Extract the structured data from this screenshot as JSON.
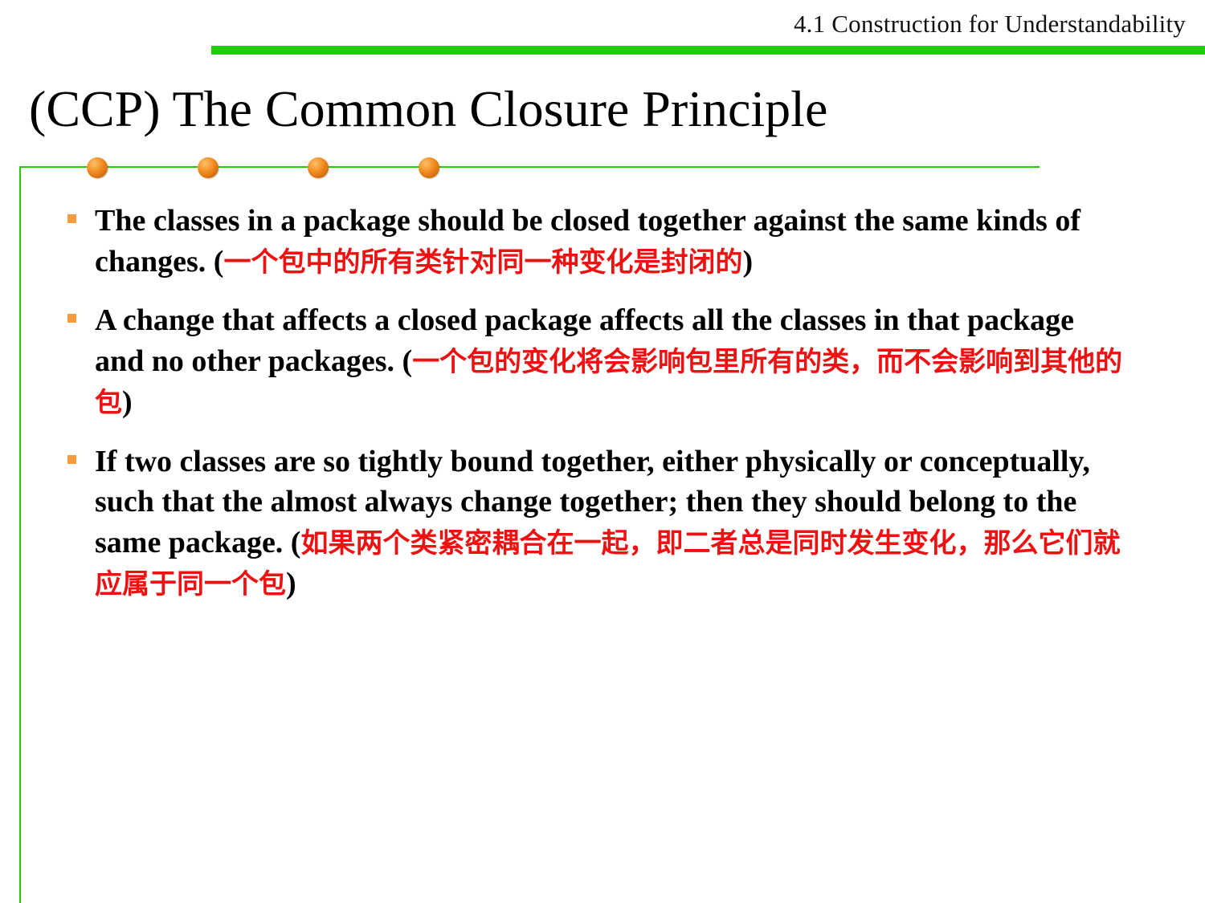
{
  "header": {
    "section": "4.1 Construction for Understandability"
  },
  "title": "(CCP) The Common Closure Principle",
  "colors": {
    "accent_green": "#22cc00",
    "bullet_orange": "#f59a3e",
    "dot_orange": "#f08a1e",
    "chinese_red": "#ee1111"
  },
  "bullets": [
    {
      "en": "The classes in a package should be closed together against the same kinds of changes. (",
      "cn": "一个包中的所有类针对同一种变化是封闭的",
      "close": ")"
    },
    {
      "en": "A change that affects a closed package affects all the classes in that package and no other packages.  (",
      "cn": "一个包的变化将会影响包里所有的类，而不会影响到其他的包",
      "close": ")"
    },
    {
      "en": "If two classes are so tightly bound together, either physically or conceptually, such that the almost always change together; then they should belong to the same package. (",
      "cn": "如果两个类紧密耦合在一起，即二者总是同时发生变化，那么它们就应属于同一个包",
      "close": ")"
    }
  ]
}
